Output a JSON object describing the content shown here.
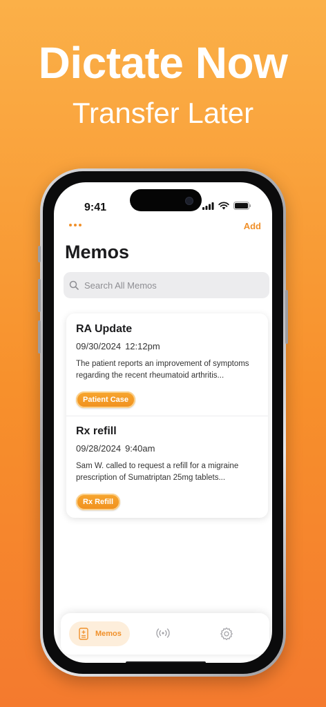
{
  "promo": {
    "headline": "Dictate Now",
    "subheadline": "Transfer Later"
  },
  "status_bar": {
    "time": "9:41"
  },
  "nav": {
    "add_label": "Add"
  },
  "page": {
    "title": "Memos"
  },
  "search": {
    "placeholder": "Search All Memos"
  },
  "memos": [
    {
      "title": "RA Update",
      "date": "09/30/2024",
      "time": "12:12pm",
      "body": "The patient reports an improvement of symptoms regarding the recent rheumatoid arthritis...",
      "tag": "Patient Case"
    },
    {
      "title": "Rx refill",
      "date": "09/28/2024",
      "time": "9:40am",
      "body": "Sam W. called to request a refill for a migraine prescription of Sumatriptan 25mg tablets...",
      "tag": "Rx Refill"
    }
  ],
  "tabbar": {
    "memos_label": "Memos"
  },
  "colors": {
    "accent": "#f0902a",
    "background_top": "#fbb048",
    "background_bottom": "#f47a2e"
  },
  "icons": [
    "more-icon",
    "search-icon",
    "memo-document-icon",
    "broadcast-icon",
    "gear-icon",
    "signal-icon",
    "wifi-icon",
    "battery-icon"
  ]
}
